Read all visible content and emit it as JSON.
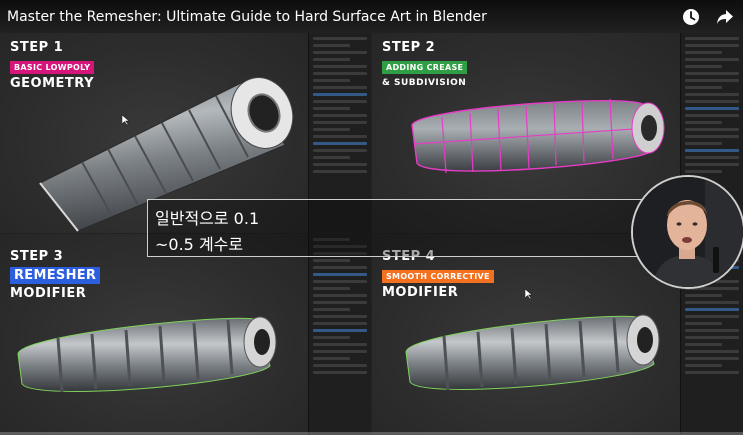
{
  "video": {
    "title": "Master the Remesher: Ultimate Guide to Hard Surface Art in Blender"
  },
  "icons": {
    "watch_later": "clock-icon",
    "share": "share-icon"
  },
  "steps": [
    {
      "step": "STEP 1",
      "tag": "BASIC LOWPOLY",
      "tag_color": "#d6157a",
      "sub": "GEOMETRY"
    },
    {
      "step": "STEP 2",
      "tag": "ADDING CREASE",
      "tag_color": "#2f9e44",
      "sub": "& SUBDIVISION"
    },
    {
      "step": "STEP 3",
      "tag": "REMESHER",
      "tag_color": "#2b5fe0",
      "sub": "MODIFIER"
    },
    {
      "step": "STEP 4",
      "tag": "SMOOTH CORRECTIVE",
      "tag_color": "#f2701f",
      "sub": "MODIFIER"
    }
  ],
  "caption": {
    "line1": "일반적으로 0.1",
    "line2": "~0.5 계수로"
  },
  "colors": {
    "wire_pink": "#e63cc6",
    "wire_green": "#7fd35a",
    "metal": "#8e9398"
  }
}
